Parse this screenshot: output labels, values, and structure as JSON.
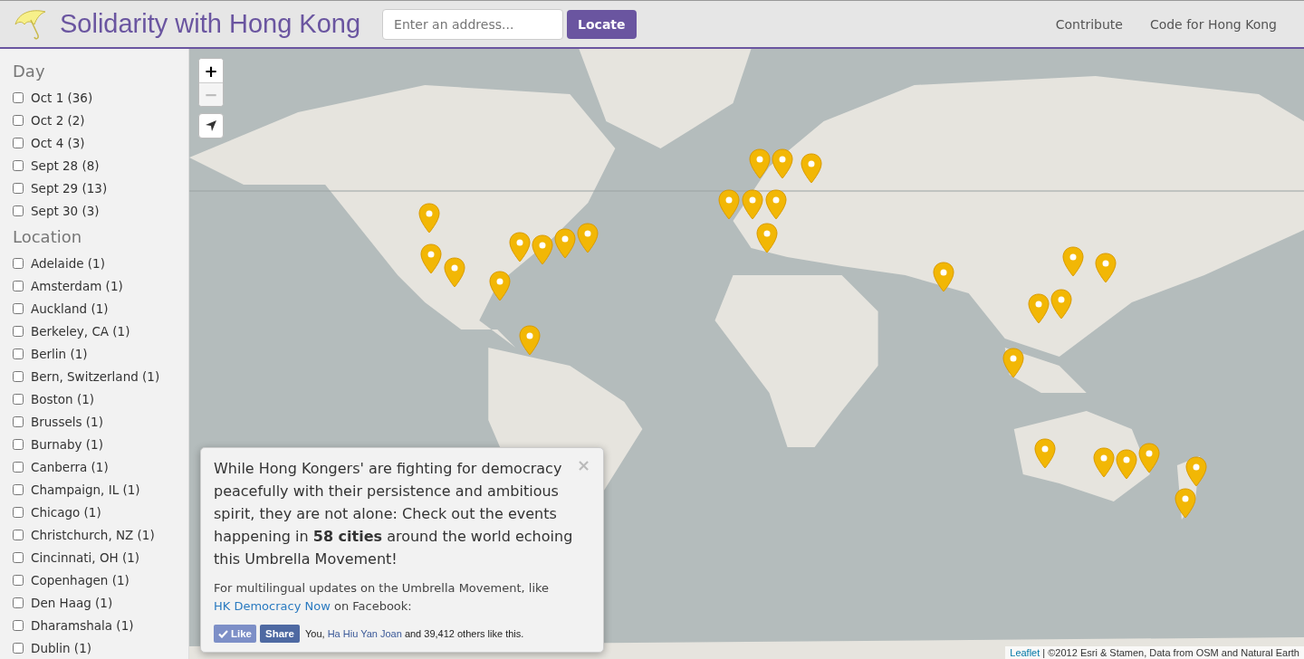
{
  "header": {
    "title": "Solidarity with Hong Kong",
    "search": {
      "placeholder": "Enter an address..."
    },
    "locate_button": "Locate",
    "nav": [
      "Contribute",
      "Code for Hong Kong"
    ]
  },
  "sidebar": {
    "groups": [
      {
        "heading": "Day",
        "items": [
          {
            "label": "Oct 1 (36)",
            "checked": false
          },
          {
            "label": "Oct 2 (2)",
            "checked": false
          },
          {
            "label": "Oct 4 (3)",
            "checked": false
          },
          {
            "label": "Sept 28 (8)",
            "checked": false
          },
          {
            "label": "Sept 29 (13)",
            "checked": false
          },
          {
            "label": "Sept 30 (3)",
            "checked": false
          }
        ]
      },
      {
        "heading": "Location",
        "items": [
          {
            "label": "Adelaide (1)",
            "checked": false
          },
          {
            "label": "Amsterdam (1)",
            "checked": false
          },
          {
            "label": "Auckland (1)",
            "checked": false
          },
          {
            "label": "Berkeley, CA (1)",
            "checked": false
          },
          {
            "label": "Berlin (1)",
            "checked": false
          },
          {
            "label": "Bern, Switzerland (1)",
            "checked": false
          },
          {
            "label": "Boston (1)",
            "checked": false
          },
          {
            "label": "Brussels (1)",
            "checked": false
          },
          {
            "label": "Burnaby (1)",
            "checked": false
          },
          {
            "label": "Canberra (1)",
            "checked": false
          },
          {
            "label": "Champaign, IL (1)",
            "checked": false
          },
          {
            "label": "Chicago (1)",
            "checked": false
          },
          {
            "label": "Christchurch, NZ (1)",
            "checked": false
          },
          {
            "label": "Cincinnati, OH (1)",
            "checked": false
          },
          {
            "label": "Copenhagen (1)",
            "checked": false
          },
          {
            "label": "Den Haag (1)",
            "checked": false
          },
          {
            "label": "Dharamshala (1)",
            "checked": false
          },
          {
            "label": "Dublin (1)",
            "checked": false
          }
        ]
      }
    ]
  },
  "map": {
    "kind": "picture",
    "zoom_in": {
      "label": "+",
      "disabled": false
    },
    "zoom_out": {
      "label": "−",
      "disabled": true
    },
    "popup": {
      "close": "×",
      "message": "While Hong Kongers' are fighting for democracy peacefully with their persistence and ambitious spirit, they are not alone: Check out the events happening in **58 cities** around the world echoing this Umbrella Movement!",
      "follow": {
        "before": "For multilingual updates on the Umbrella Movement, like ",
        "link": "HK Democracy Now",
        "after": " on Facebook:"
      },
      "like_button": {
        "label": "Like",
        "checked": true
      },
      "share_button": "Share",
      "social": {
        "before": "You, ",
        "link": "Ha Hiu Yan Joan",
        "after": " and 39,412 others like this."
      }
    },
    "attribution": {
      "link": "Leaflet",
      "text": " | ©2012 Esri & Stamen, Data from OSM and Natural Earth"
    }
  }
}
